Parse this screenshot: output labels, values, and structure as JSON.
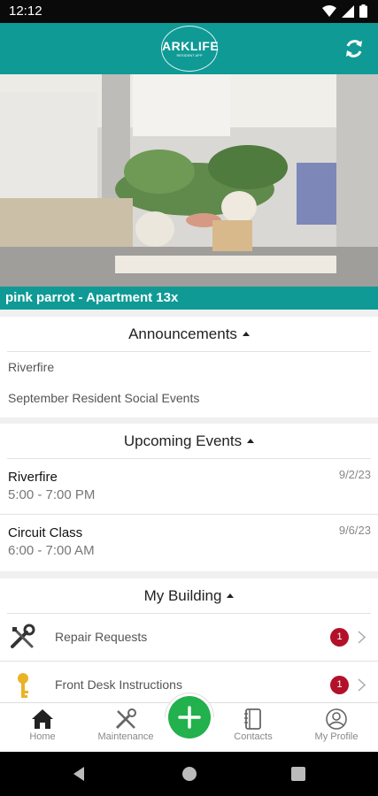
{
  "status": {
    "time": "12:12"
  },
  "header": {
    "brand": "ARKLIFE",
    "tagline": "RESIDENT APP",
    "accent": "#0f9a96"
  },
  "property": {
    "caption": "pink parrot - Apartment 13x"
  },
  "announcements": {
    "title": "Announcements",
    "items": [
      "Riverfire",
      "September Resident Social Events"
    ]
  },
  "events": {
    "title": "Upcoming Events",
    "items": [
      {
        "name": "Riverfire",
        "time": "5:00 - 7:00 PM",
        "date": "9/2/23"
      },
      {
        "name": "Circuit Class",
        "time": "6:00 - 7:00 AM",
        "date": "9/6/23"
      }
    ]
  },
  "building": {
    "title": "My Building",
    "items": [
      {
        "label": "Repair Requests",
        "badge": "1",
        "icon": "tools-icon"
      },
      {
        "label": "Front Desk Instructions",
        "badge": "1",
        "icon": "key-icon"
      }
    ]
  },
  "tabs": [
    {
      "label": "Home",
      "icon": "home-icon"
    },
    {
      "label": "Maintenance",
      "icon": "maintenance-icon"
    },
    {
      "label": "Contacts",
      "icon": "contacts-icon"
    },
    {
      "label": "My Profile",
      "icon": "profile-icon"
    }
  ],
  "fab": {
    "icon": "plus-icon",
    "color": "#22b14c"
  },
  "badge_color": "#b3112a"
}
